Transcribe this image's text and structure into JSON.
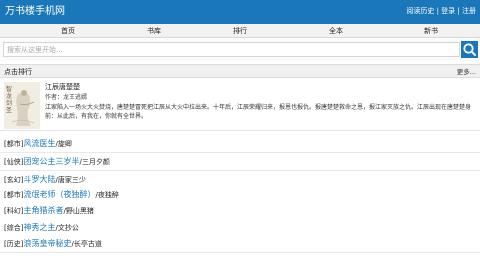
{
  "header": {
    "site_title": "万书楼手机网",
    "links": [
      "阅读历史",
      "登录",
      "注册"
    ],
    "separator": "|"
  },
  "nav": {
    "items": [
      {
        "label": "首页"
      },
      {
        "label": "书库"
      },
      {
        "label": "排行"
      },
      {
        "label": "全本"
      },
      {
        "label": "新书"
      }
    ]
  },
  "search": {
    "placeholder": "搜索从这里开始...",
    "button_icon": "search-icon"
  },
  "section": {
    "title": "点击排行",
    "more": "更多..."
  },
  "featured": {
    "title": "江辰唐楚楚",
    "author_label": "作者：",
    "author": "龙王逃婿",
    "description": "江家陷入一场火大火焚烧，唐楚楚冒死把江辰从大火中拉出来。十年后，江辰荣耀归来，报恩也报仇。报唐楚楚救命之恩，报江家灭族之仇。江辰出现在唐楚楚身前：从此后，有我在，你就有全世界。",
    "cover_text": "智龙剑圣"
  },
  "books": [
    {
      "category": "[都市]",
      "title": "风流医生",
      "author": "旋卿"
    },
    {
      "category": "[仙侠]",
      "title": "团宠公主三岁半",
      "author": "三月夕颜"
    },
    {
      "category": "[玄幻]",
      "title": "斗罗大陆",
      "author": "唐家三少"
    },
    {
      "category": "[都市]",
      "title": "流氓老师（夜独醉）",
      "author": "夜独醉"
    },
    {
      "category": "[科幻]",
      "title": "主角猎杀者",
      "author": "野山黑猪"
    },
    {
      "category": "[综合]",
      "title": "神秀之主",
      "author": "文抄公"
    },
    {
      "category": "[历史]",
      "title": "浪荡皇帝秘史",
      "author": "长亭古道"
    }
  ],
  "colors": {
    "brand": "#1a77b9",
    "nav_bg": "#f2f2f2",
    "text": "#222222"
  }
}
